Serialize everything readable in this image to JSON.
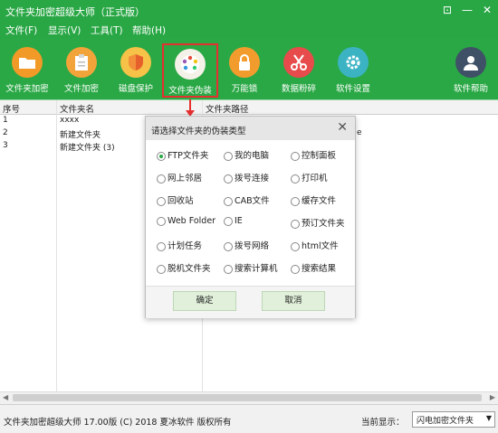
{
  "window": {
    "title": "文件夹加密超级大师（正式版）"
  },
  "menu": [
    "文件(F)",
    "显示(V)",
    "工具(T)",
    "帮助(H)"
  ],
  "toolbar": [
    {
      "label": "文件夹加密",
      "icon": "folder-icon"
    },
    {
      "label": "文件加密",
      "icon": "clipboard-icon"
    },
    {
      "label": "磁盘保护",
      "icon": "shield-icon"
    },
    {
      "label": "文件夹伪装",
      "icon": "palette-icon"
    },
    {
      "label": "万能锁",
      "icon": "lock-icon"
    },
    {
      "label": "数据粉碎",
      "icon": "scissors-icon"
    },
    {
      "label": "软件设置",
      "icon": "gear-icon"
    },
    {
      "label": "软件帮助",
      "icon": "user-icon"
    }
  ],
  "table": {
    "headers": [
      "序号",
      "文件夹名",
      "文件夹路径"
    ],
    "rows": [
      {
        "no": "1",
        "name": "xxxx",
        "path": ""
      },
      {
        "no": "2",
        "name": "新建文件夹",
        "path": "e"
      },
      {
        "no": "3",
        "name": "新建文件夹 (3)",
        "path": ""
      }
    ]
  },
  "dialog": {
    "title": "请选择文件夹的伪装类型",
    "options": [
      [
        "FTP文件夹",
        "我的电脑",
        "控制面板"
      ],
      [
        "网上邻居",
        "拨号连接",
        "打印机"
      ],
      [
        "回收站",
        "CAB文件",
        "缓存文件"
      ],
      [
        "Web Folder",
        "IE",
        "预订文件夹"
      ],
      [
        "计划任务",
        "拨号网络",
        "html文件"
      ],
      [
        "脱机文件夹",
        "搜索计算机",
        "搜索结果"
      ]
    ],
    "selected": "FTP文件夹",
    "ok": "确定",
    "cancel": "取消"
  },
  "status": {
    "version": "文件夹加密超级大师 17.00版 (C) 2018  夏冰软件 版权所有",
    "current_label": "当前显示：",
    "current_value": "闪电加密文件夹"
  },
  "colors": {
    "accent": "#29a745",
    "highlight": "#e53030"
  }
}
